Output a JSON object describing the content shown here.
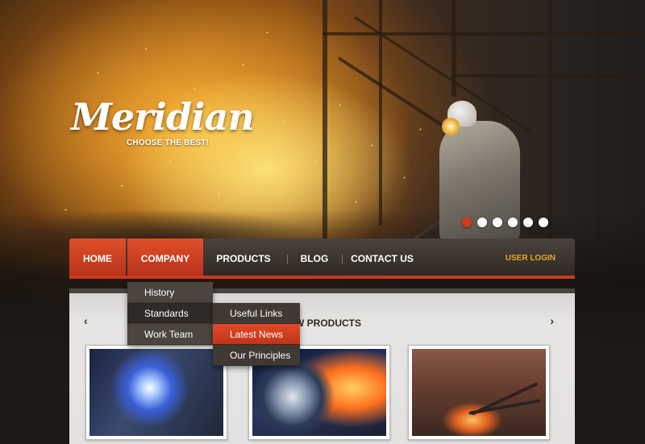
{
  "brand": {
    "logo": "Meridian",
    "tagline": "CHOOSE THE BEST!"
  },
  "slider": {
    "total": 6,
    "active": 0
  },
  "nav": {
    "home": "HOME",
    "company": "COMPANY",
    "products": "PRODUCTS",
    "blog": "BLOG",
    "contact": "CONTACT US",
    "login": "USER LOGIN"
  },
  "dropdown": {
    "items": [
      "History",
      "Standards",
      "Work Team"
    ]
  },
  "submenu": {
    "items": [
      "Useful Links",
      "Latest News",
      "Our Principles"
    ]
  },
  "section": {
    "title": "W PRODUCTS",
    "prev": "‹",
    "next": "›"
  },
  "colors": {
    "accent": "#c83a1c",
    "login": "#e8a820",
    "nav_bg": "#2f2925"
  }
}
